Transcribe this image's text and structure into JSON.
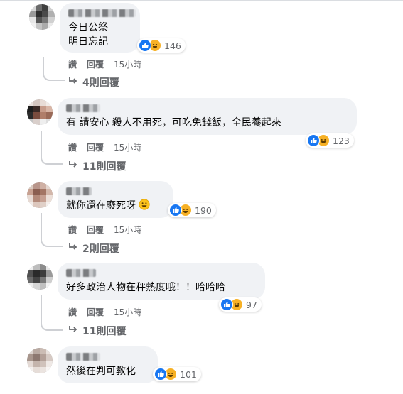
{
  "comments": [
    {
      "text_lines": [
        "今日公祭",
        "明日忘記"
      ],
      "reaction_count": "146",
      "actions": {
        "like": "讚",
        "reply": "回覆",
        "time": "15小時"
      },
      "replies": "4則回覆"
    },
    {
      "text_lines": [
        "有 請安心 殺人不用死，可吃免錢飯，全民養起來"
      ],
      "reaction_count": "123",
      "actions": {
        "like": "讚",
        "reply": "回覆",
        "time": "15小時"
      },
      "replies": "11則回覆"
    },
    {
      "text_lines": [
        "就你還在廢死呀"
      ],
      "reaction_count": "190",
      "actions": {
        "like": "讚",
        "reply": "回覆",
        "time": "15小時"
      },
      "replies": "2則回覆"
    },
    {
      "text_lines": [
        "好多政治人物在秤熱度哦！！哈哈哈"
      ],
      "reaction_count": "97",
      "actions": {
        "like": "讚",
        "reply": "回覆",
        "time": "15小時"
      },
      "replies": "11則回覆"
    },
    {
      "text_lines": [
        "然後在判可教化"
      ],
      "reaction_count": "101"
    }
  ],
  "icons": {
    "like": "thumbs-up-icon",
    "haha": "laughing-face-icon",
    "reply_arrow": "reply-arrow-icon",
    "emoji": "smiley-emoji-icon"
  },
  "colors": {
    "bubble": "#f0f2f5",
    "like_blue": "#1877f2",
    "haha_yellow": "#f7b125",
    "meta_gray": "#65676b"
  }
}
